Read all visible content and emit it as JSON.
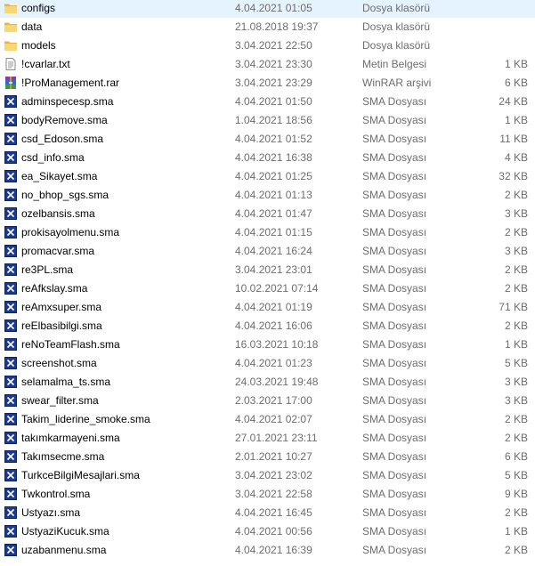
{
  "files": [
    {
      "name": "configs",
      "date": "4.04.2021 01:05",
      "type": "Dosya klasörü",
      "size": "",
      "icon": "folder-icon"
    },
    {
      "name": "data",
      "date": "21.08.2018 19:37",
      "type": "Dosya klasörü",
      "size": "",
      "icon": "folder-icon"
    },
    {
      "name": "models",
      "date": "3.04.2021 22:50",
      "type": "Dosya klasörü",
      "size": "",
      "icon": "folder-icon"
    },
    {
      "name": "!cvarlar.txt",
      "date": "3.04.2021 23:30",
      "type": "Metin Belgesi",
      "size": "1 KB",
      "icon": "text-file-icon"
    },
    {
      "name": "!ProManagement.rar",
      "date": "3.04.2021 23:29",
      "type": "WinRAR arşivi",
      "size": "6 KB",
      "icon": "winrar-icon"
    },
    {
      "name": "adminspecesp.sma",
      "date": "4.04.2021 01:50",
      "type": "SMA Dosyası",
      "size": "24 KB",
      "icon": "sma-file-icon"
    },
    {
      "name": "bodyRemove.sma",
      "date": "1.04.2021 18:56",
      "type": "SMA Dosyası",
      "size": "1 KB",
      "icon": "sma-file-icon"
    },
    {
      "name": "csd_Edoson.sma",
      "date": "4.04.2021 01:52",
      "type": "SMA Dosyası",
      "size": "11 KB",
      "icon": "sma-file-icon"
    },
    {
      "name": "csd_info.sma",
      "date": "4.04.2021 16:38",
      "type": "SMA Dosyası",
      "size": "4 KB",
      "icon": "sma-file-icon"
    },
    {
      "name": "ea_Sikayet.sma",
      "date": "4.04.2021 01:25",
      "type": "SMA Dosyası",
      "size": "32 KB",
      "icon": "sma-file-icon"
    },
    {
      "name": "no_bhop_sgs.sma",
      "date": "4.04.2021 01:13",
      "type": "SMA Dosyası",
      "size": "2 KB",
      "icon": "sma-file-icon"
    },
    {
      "name": "ozelbansis.sma",
      "date": "4.04.2021 01:47",
      "type": "SMA Dosyası",
      "size": "3 KB",
      "icon": "sma-file-icon"
    },
    {
      "name": "prokisayolmenu.sma",
      "date": "4.04.2021 01:15",
      "type": "SMA Dosyası",
      "size": "2 KB",
      "icon": "sma-file-icon"
    },
    {
      "name": "promacvar.sma",
      "date": "4.04.2021 16:24",
      "type": "SMA Dosyası",
      "size": "3 KB",
      "icon": "sma-file-icon"
    },
    {
      "name": "re3PL.sma",
      "date": "3.04.2021 23:01",
      "type": "SMA Dosyası",
      "size": "2 KB",
      "icon": "sma-file-icon"
    },
    {
      "name": "reAfkslay.sma",
      "date": "10.02.2021 07:14",
      "type": "SMA Dosyası",
      "size": "2 KB",
      "icon": "sma-file-icon"
    },
    {
      "name": "reAmxsuper.sma",
      "date": "4.04.2021 01:19",
      "type": "SMA Dosyası",
      "size": "71 KB",
      "icon": "sma-file-icon"
    },
    {
      "name": "reElbasibilgi.sma",
      "date": "4.04.2021 16:06",
      "type": "SMA Dosyası",
      "size": "2 KB",
      "icon": "sma-file-icon"
    },
    {
      "name": "reNoTeamFlash.sma",
      "date": "16.03.2021 10:18",
      "type": "SMA Dosyası",
      "size": "1 KB",
      "icon": "sma-file-icon"
    },
    {
      "name": "screenshot.sma",
      "date": "4.04.2021 01:23",
      "type": "SMA Dosyası",
      "size": "5 KB",
      "icon": "sma-file-icon"
    },
    {
      "name": "selamalma_ts.sma",
      "date": "24.03.2021 19:48",
      "type": "SMA Dosyası",
      "size": "3 KB",
      "icon": "sma-file-icon"
    },
    {
      "name": "swear_filter.sma",
      "date": "2.03.2021 17:00",
      "type": "SMA Dosyası",
      "size": "3 KB",
      "icon": "sma-file-icon"
    },
    {
      "name": "Takim_liderine_smoke.sma",
      "date": "4.04.2021 02:07",
      "type": "SMA Dosyası",
      "size": "2 KB",
      "icon": "sma-file-icon"
    },
    {
      "name": "takımkarmayeni.sma",
      "date": "27.01.2021 23:11",
      "type": "SMA Dosyası",
      "size": "2 KB",
      "icon": "sma-file-icon"
    },
    {
      "name": "Takımsecme.sma",
      "date": "2.01.2021 10:27",
      "type": "SMA Dosyası",
      "size": "6 KB",
      "icon": "sma-file-icon"
    },
    {
      "name": "TurkceBilgiMesajlari.sma",
      "date": "3.04.2021 23:02",
      "type": "SMA Dosyası",
      "size": "5 KB",
      "icon": "sma-file-icon"
    },
    {
      "name": "Twkontrol.sma",
      "date": "3.04.2021 22:58",
      "type": "SMA Dosyası",
      "size": "9 KB",
      "icon": "sma-file-icon"
    },
    {
      "name": "Ustyazı.sma",
      "date": "4.04.2021 16:45",
      "type": "SMA Dosyası",
      "size": "2 KB",
      "icon": "sma-file-icon"
    },
    {
      "name": "UstyaziKucuk.sma",
      "date": "4.04.2021 00:56",
      "type": "SMA Dosyası",
      "size": "1 KB",
      "icon": "sma-file-icon"
    },
    {
      "name": "uzabanmenu.sma",
      "date": "4.04.2021 16:39",
      "type": "SMA Dosyası",
      "size": "2 KB",
      "icon": "sma-file-icon"
    }
  ]
}
